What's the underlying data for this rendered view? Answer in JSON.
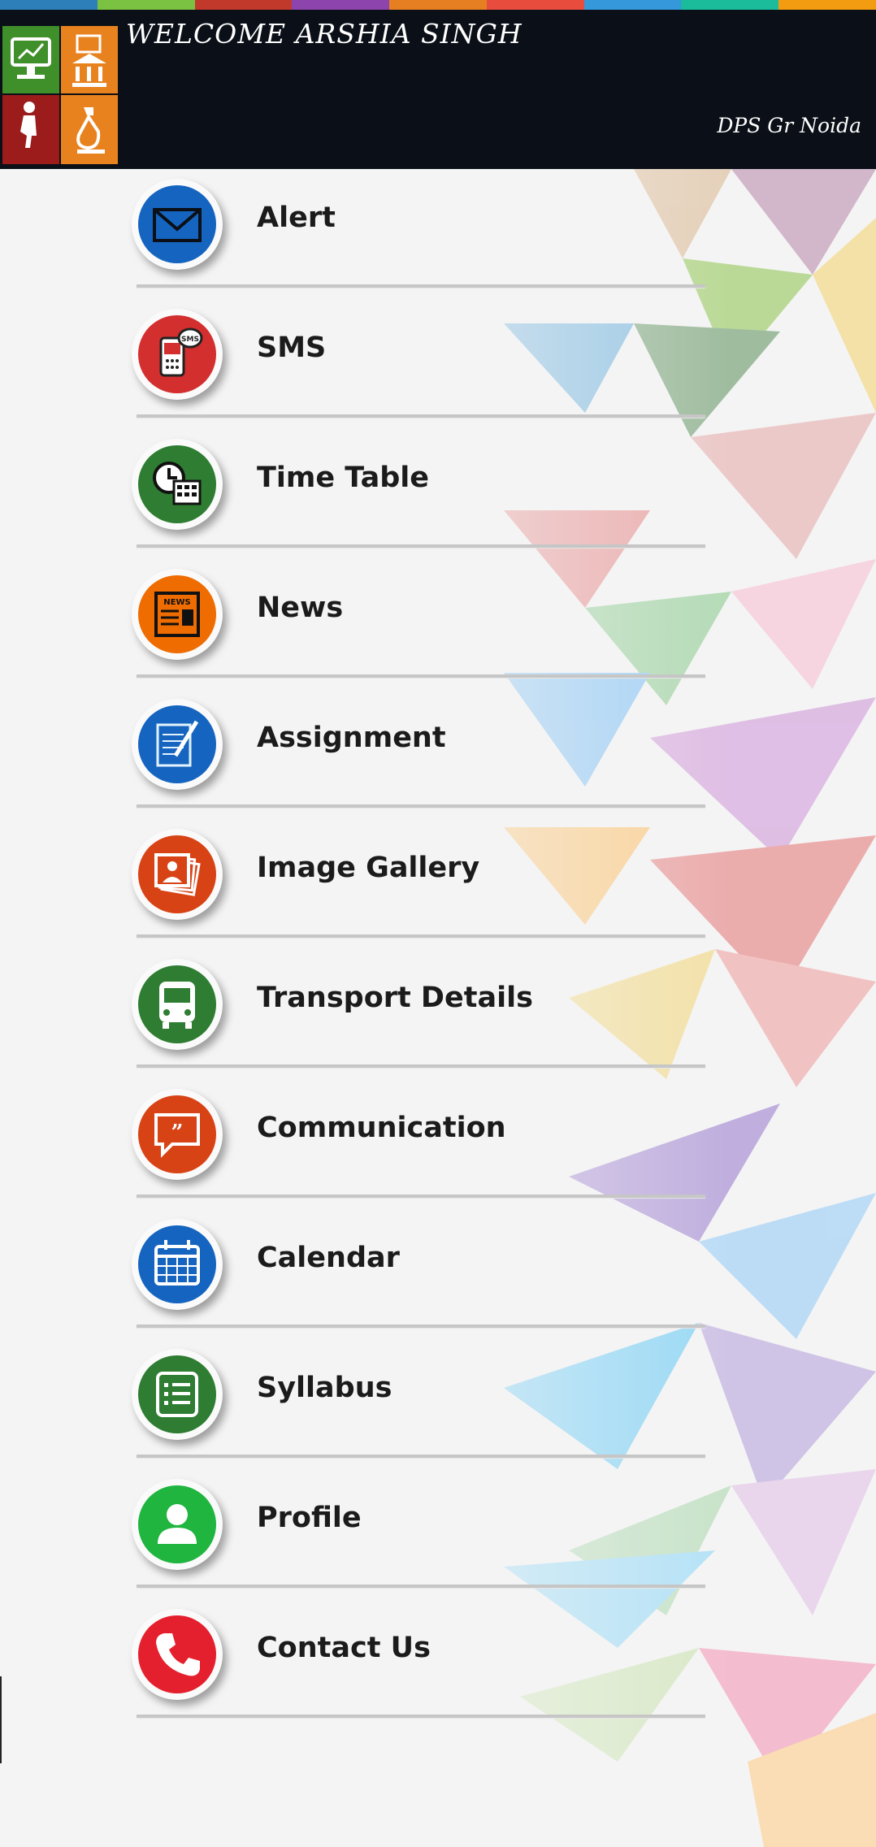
{
  "header": {
    "welcome": "WELCOME ARSHIA SINGH",
    "school": "DPS Gr Noida",
    "stripe_colors": [
      "#2c7fb8",
      "#7cc242",
      "#c0392b",
      "#8e44ad",
      "#e67e22",
      "#e74c3c",
      "#3498db",
      "#1abc9c",
      "#f39c12"
    ]
  },
  "menu": {
    "items": [
      {
        "label": "Alert",
        "icon": "envelope-icon",
        "color": "#1565c0"
      },
      {
        "label": "SMS",
        "icon": "sms-phone-icon",
        "color": "#d32f2f"
      },
      {
        "label": "Time Table",
        "icon": "clock-calendar-icon",
        "color": "#2e7d32"
      },
      {
        "label": "News",
        "icon": "newspaper-icon",
        "color": "#ef6c00"
      },
      {
        "label": "Assignment",
        "icon": "notepad-pen-icon",
        "color": "#1565c0"
      },
      {
        "label": "Image Gallery",
        "icon": "photo-stack-icon",
        "color": "#d84315"
      },
      {
        "label": "Transport Details",
        "icon": "bus-icon",
        "color": "#2e7d32"
      },
      {
        "label": "Communication",
        "icon": "chat-bubble-icon",
        "color": "#d84315"
      },
      {
        "label": "Calendar",
        "icon": "calendar-icon",
        "color": "#1565c0"
      },
      {
        "label": "Syllabus",
        "icon": "list-document-icon",
        "color": "#2e7d32"
      },
      {
        "label": "Profile",
        "icon": "user-icon",
        "color": "#1fb53f"
      },
      {
        "label": "Contact Us",
        "icon": "phone-handset-icon",
        "color": "#e5202e"
      }
    ]
  }
}
